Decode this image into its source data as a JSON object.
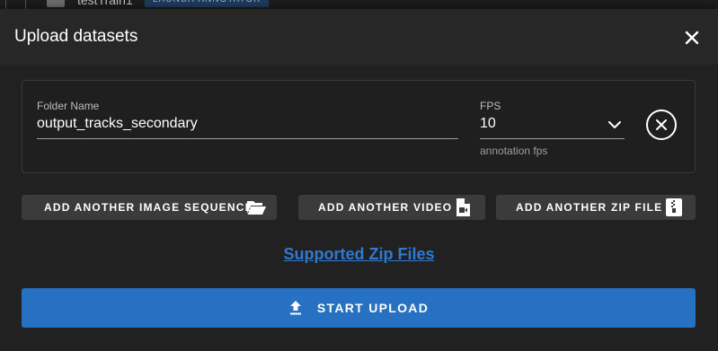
{
  "background": {
    "row_name": "testTrain1",
    "chip_label": "LAUNCH ANNOTATOR"
  },
  "dialog": {
    "title": "Upload datasets",
    "close_icon": "close-icon"
  },
  "form": {
    "folder_name_label": "Folder Name",
    "folder_name_value": "output_tracks_secondary",
    "fps_label": "FPS",
    "fps_value": "10",
    "fps_hint": "annotation fps",
    "remove_icon": "circle-close-icon"
  },
  "buttons": {
    "image_sequence": "ADD ANOTHER IMAGE SEQUENCE",
    "video": "ADD ANOTHER VIDEO",
    "zip": "ADD ANOTHER ZIP FILE",
    "supported_zip": "Supported Zip Files",
    "start_upload": "START UPLOAD"
  },
  "colors": {
    "primary": "#2671c2",
    "link": "#2e7ad1",
    "button_bg": "#3b3b3b",
    "dialog_bg": "#212121"
  }
}
